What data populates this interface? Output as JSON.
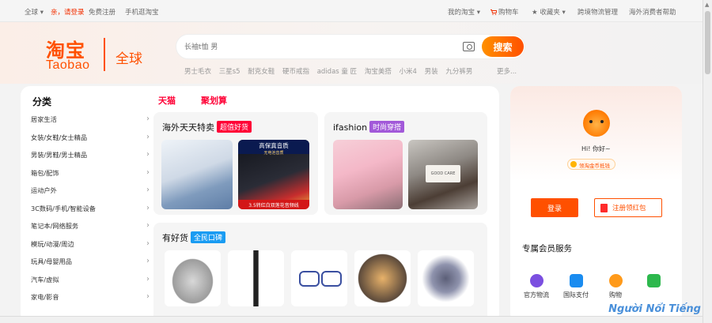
{
  "topbar": {
    "global": "全球",
    "greeting": "亲，请登录",
    "register": "免费注册",
    "mobile": "手机逛淘宝",
    "my_taobao": "我的淘宝",
    "cart": "购物车",
    "favorites": "收藏夹",
    "logistics": "跨境物流管理",
    "help": "海外消费者帮助"
  },
  "logo": {
    "cn": "淘宝",
    "en": "Taobao",
    "global": "全球"
  },
  "search": {
    "placeholder": "长袖t恤 男",
    "button": "搜索",
    "hotwords": [
      "男士毛衣",
      "三星s5",
      "耐克女鞋",
      "硬币戒指",
      "adidas 童 匠",
      "淘宝美搭",
      "小米4",
      "男装",
      "九分裤男"
    ],
    "more": "更多..."
  },
  "categories": {
    "title": "分类",
    "items": [
      "居家生活",
      "女装/女鞋/女士精品",
      "男装/男鞋/男士精品",
      "箱包/配饰",
      "运动户外",
      "3C数码/手机/智能设备",
      "笔记本/网络服务",
      "模玩/动漫/周边",
      "玩具/母婴用品",
      "汽车/虚拟",
      "家电/影音"
    ]
  },
  "tabs": {
    "tmall": "天猫",
    "juhuasuan": "聚划算"
  },
  "panels": {
    "overseas": {
      "title": "海外天天特卖",
      "tag": "超值好货"
    },
    "ifashion": {
      "title": "ifashion",
      "tag": "时尚穿搭"
    },
    "goodgoods": {
      "title": "有好货",
      "tag": "全民口碑"
    },
    "cable": {
      "brand": "高保真音质",
      "sub": "无电池音质",
      "bottom": "3.5转红白双莲花音频线"
    },
    "candle": {
      "label": "GOOD CARE"
    }
  },
  "member": {
    "greeting": "Hi! 你好~",
    "coin": "领淘金币抵钱",
    "login": "登录",
    "register": "注册领红包",
    "service_title": "专属会员服务",
    "services": [
      {
        "label": "官方物流",
        "color": "#7b4fe0"
      },
      {
        "label": "国际支付",
        "color": "#1a8cf0"
      },
      {
        "label": "购物",
        "color": "#ff9a1a"
      },
      {
        "label": "",
        "color": "#2db84d"
      }
    ]
  },
  "watermark": "Người Nổi Tiếng"
}
